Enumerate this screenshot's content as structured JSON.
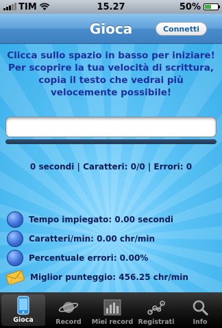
{
  "status_bar": {
    "carrier": "TIM",
    "time": "15.27",
    "battery": "50%",
    "battery_level": 0.5
  },
  "nav": {
    "title": "Gioca",
    "connect_label": "Connetti"
  },
  "main": {
    "instructions": "Clicca sullo spazio in basso per iniziare! Per scoprire la tua velocità di scrittura, copia il testo che vedrai più velocemente possibile!",
    "typing_value": "",
    "progress": 0,
    "counters": "0 secondi | Caratteri: 0/0 | Errori: 0"
  },
  "stats": [
    {
      "icon": "blue-dot-icon",
      "text": "Tempo impiegato: 0.00 secondi"
    },
    {
      "icon": "blue-dot-icon",
      "text": "Caratteri/min: 0.00 chr/min"
    },
    {
      "icon": "blue-dot-icon",
      "text": "Percentuale errori: 0.00%"
    },
    {
      "icon": "envelope-icon",
      "text": "Miglior punteggio: 456.25 chr/min"
    }
  ],
  "tabs": [
    {
      "label": "Gioca",
      "icon": "phone-icon",
      "active": true
    },
    {
      "label": "Record",
      "icon": "planet-icon",
      "active": false
    },
    {
      "label": "Miei record",
      "icon": "bar-chart-icon",
      "active": false
    },
    {
      "label": "Registrati",
      "icon": "molecule-icon",
      "active": false
    },
    {
      "label": "Info",
      "icon": "search-icon",
      "active": false
    }
  ],
  "colors": {
    "instruction_text": "#1d2f9e",
    "body_text": "#0b1b55",
    "background_blue": "#5cc3f5",
    "progress_fill": "#76d24a"
  }
}
